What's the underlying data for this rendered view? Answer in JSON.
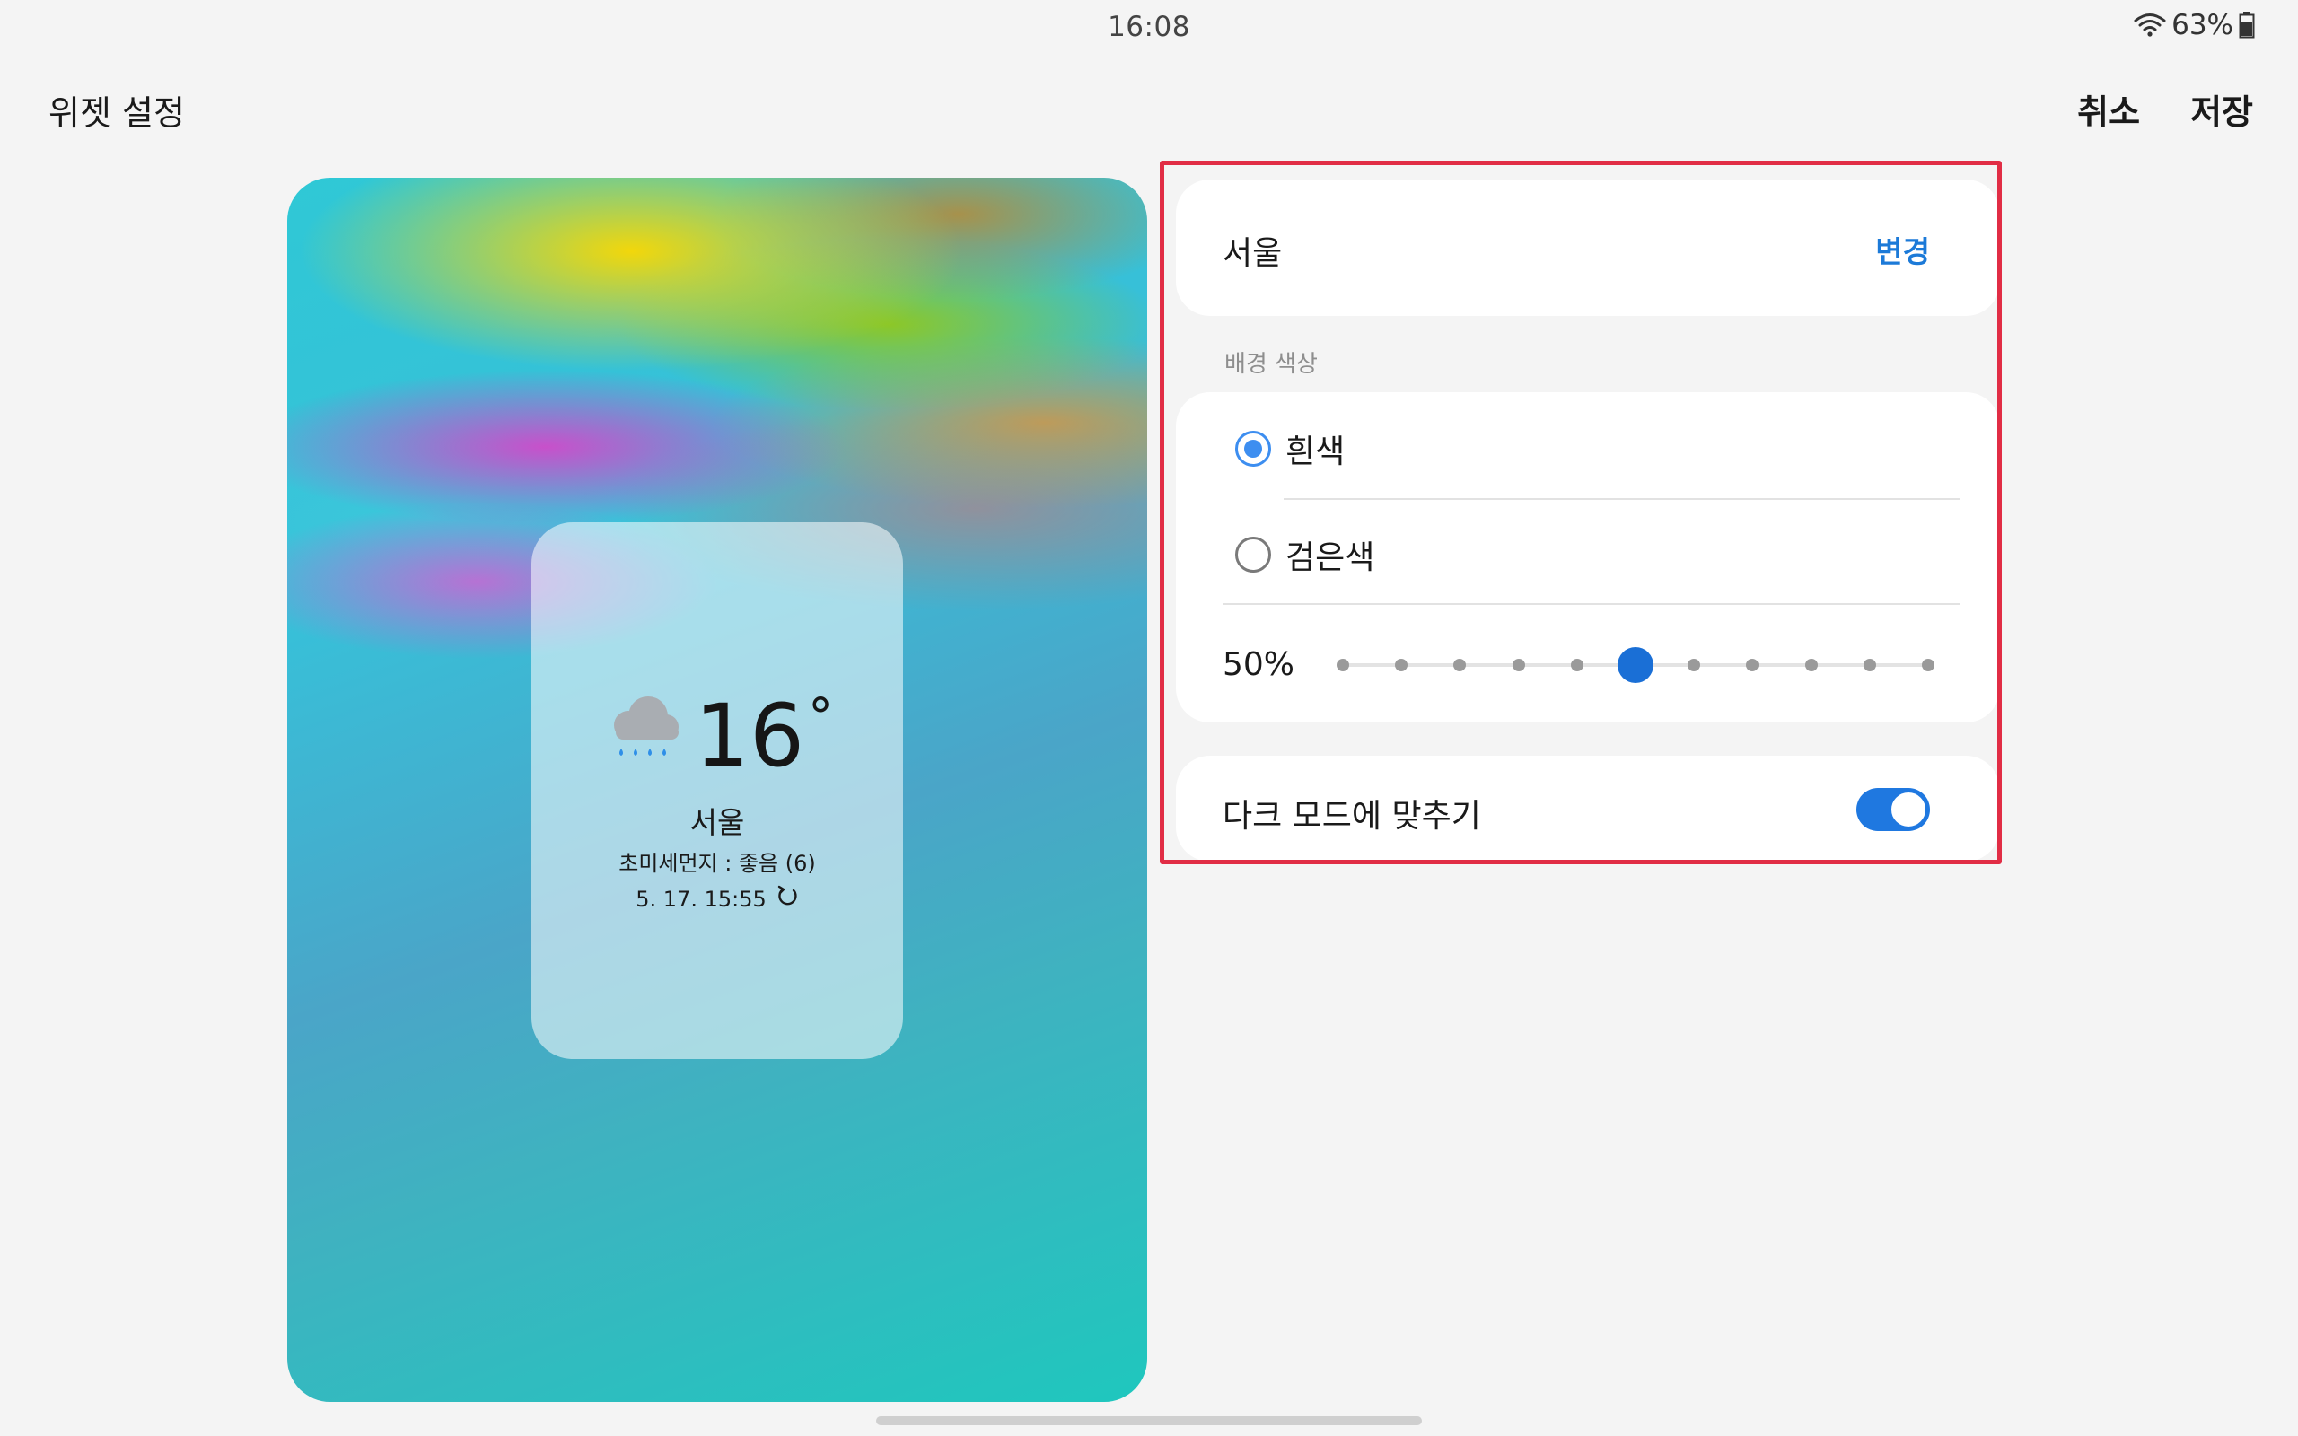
{
  "status_bar": {
    "time": "16:08",
    "battery": "63%",
    "icons": [
      "wifi-icon",
      "battery-icon"
    ]
  },
  "header": {
    "title": "위젯 설정",
    "cancel_label": "취소",
    "save_label": "저장"
  },
  "preview": {
    "widget": {
      "weather_icon": "rain-cloud-icon",
      "temperature": "16",
      "degree_symbol": "°",
      "city": "서울",
      "fine_dust": "초미세먼지 : 좋음 (6)",
      "updated": "5. 17. 15:55",
      "refresh_icon": "refresh-icon"
    }
  },
  "settings": {
    "location": {
      "city": "서울",
      "change_label": "변경"
    },
    "background": {
      "section_label": "배경 색상",
      "options": [
        {
          "label": "흰색",
          "selected": true
        },
        {
          "label": "검은색",
          "selected": false
        }
      ],
      "transparency_label": "50%",
      "transparency_value": 0.5,
      "slider_steps": 11
    },
    "dark_mode": {
      "label": "다크 모드에 맞추기",
      "enabled": true
    }
  },
  "colors": {
    "accent": "#1c7ad8",
    "highlight_outline": "#e12d45",
    "background": "#f4f4f4"
  }
}
